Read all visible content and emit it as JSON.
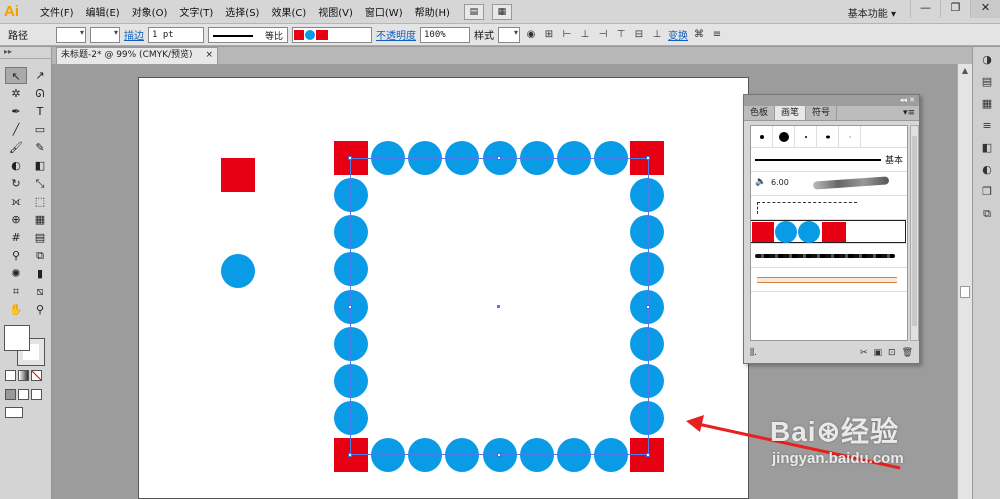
{
  "app": {
    "logo": "Ai",
    "workspace": "基本功能 ▾"
  },
  "menu": [
    "文件(F)",
    "编辑(E)",
    "对象(O)",
    "文字(T)",
    "选择(S)",
    "效果(C)",
    "视图(V)",
    "窗口(W)",
    "帮助(H)"
  ],
  "window_buttons": {
    "min": "—",
    "max": "❐",
    "close": "✕"
  },
  "control_bar": {
    "object_type": "路径",
    "stroke_link": "描边",
    "stroke_weight": "1 pt",
    "stroke_profile": "等比",
    "opacity_link": "不透明度",
    "opacity_value": "100%",
    "style_label": "样式",
    "transform_link": "变换"
  },
  "document_tab": {
    "title": "未标题-2* @ 99% (CMYK/预览)",
    "close": "×"
  },
  "tools": [
    {
      "name": "selection-tool",
      "glyph": "↖",
      "active": true
    },
    {
      "name": "direct-selection-tool",
      "glyph": "↗",
      "active": false
    },
    {
      "name": "magic-wand-tool",
      "glyph": "✲",
      "active": false
    },
    {
      "name": "lasso-tool",
      "glyph": "ᘏ",
      "active": false
    },
    {
      "name": "pen-tool",
      "glyph": "✒",
      "active": false
    },
    {
      "name": "type-tool",
      "glyph": "T",
      "active": false
    },
    {
      "name": "line-tool",
      "glyph": "╱",
      "active": false
    },
    {
      "name": "rectangle-tool",
      "glyph": "▭",
      "active": false
    },
    {
      "name": "paintbrush-tool",
      "glyph": "🖌",
      "active": false
    },
    {
      "name": "pencil-tool",
      "glyph": "✎",
      "active": false
    },
    {
      "name": "blob-brush-tool",
      "glyph": "◐",
      "active": false
    },
    {
      "name": "eraser-tool",
      "glyph": "◧",
      "active": false
    },
    {
      "name": "rotate-tool",
      "glyph": "↻",
      "active": false
    },
    {
      "name": "scale-tool",
      "glyph": "⤡",
      "active": false
    },
    {
      "name": "width-tool",
      "glyph": "⟗",
      "active": false
    },
    {
      "name": "free-transform-tool",
      "glyph": "⬚",
      "active": false
    },
    {
      "name": "shape-builder-tool",
      "glyph": "⊕",
      "active": false
    },
    {
      "name": "perspective-grid-tool",
      "glyph": "▦",
      "active": false
    },
    {
      "name": "mesh-tool",
      "glyph": "#",
      "active": false
    },
    {
      "name": "gradient-tool",
      "glyph": "▤",
      "active": false
    },
    {
      "name": "eyedropper-tool",
      "glyph": "⚲",
      "active": false
    },
    {
      "name": "blend-tool",
      "glyph": "⧉",
      "active": false
    },
    {
      "name": "symbol-sprayer-tool",
      "glyph": "✺",
      "active": false
    },
    {
      "name": "column-graph-tool",
      "glyph": "▮",
      "active": false
    },
    {
      "name": "artboard-tool",
      "glyph": "⌗",
      "active": false
    },
    {
      "name": "slice-tool",
      "glyph": "⧅",
      "active": false
    },
    {
      "name": "hand-tool",
      "glyph": "✋",
      "active": false
    },
    {
      "name": "zoom-tool",
      "glyph": "⚲",
      "active": false
    }
  ],
  "brush_panel": {
    "collapse": "◂◂  ✕",
    "tabs": [
      "色板",
      "画笔",
      "符号"
    ],
    "active_tab": 1,
    "menu_glyph": "▾≡",
    "basic_label": "基本",
    "art_brush_size": "6.00",
    "footer": {
      "library": "⫼.",
      "remove": "✂",
      "options": "▣",
      "new": "⊡",
      "delete": "🗑"
    }
  },
  "colors": {
    "red": "#e60012",
    "blue": "#0a9be6",
    "selection": "#4a7df0",
    "arrow": "#e8201e"
  },
  "watermark": {
    "logo": "Bai⊛经验",
    "url": "jingyan.baidu.com"
  }
}
